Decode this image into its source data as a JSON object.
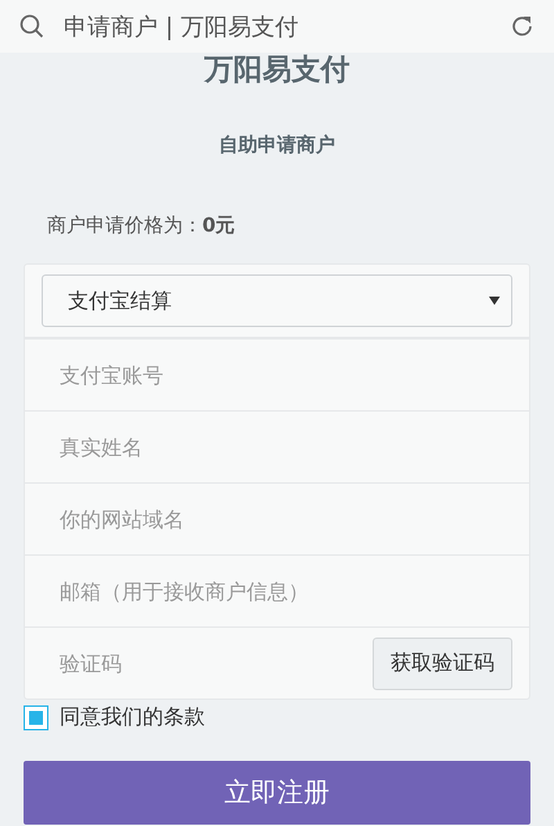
{
  "address_bar": {
    "title": "申请商户 | 万阳易支付"
  },
  "site_title": "万阳易支付",
  "heading": "自助申请商户",
  "price_note": "商户申请价格为：**0元**",
  "form": {
    "settlement": {
      "value": "支付宝结算"
    },
    "fields": [
      {
        "kind": "text",
        "placeholder": "支付宝账号"
      },
      {
        "kind": "text",
        "placeholder": "真实姓名"
      },
      {
        "kind": "text",
        "placeholder": "你的网站域名"
      },
      {
        "kind": "text",
        "placeholder": "邮箱（用于接收商户信息）"
      },
      {
        "kind": "code",
        "placeholder": "验证码",
        "button": "获取验证码"
      }
    ]
  },
  "agree": {
    "label": "同意我们的条款",
    "checked": true
  },
  "submit": "立即注册"
}
